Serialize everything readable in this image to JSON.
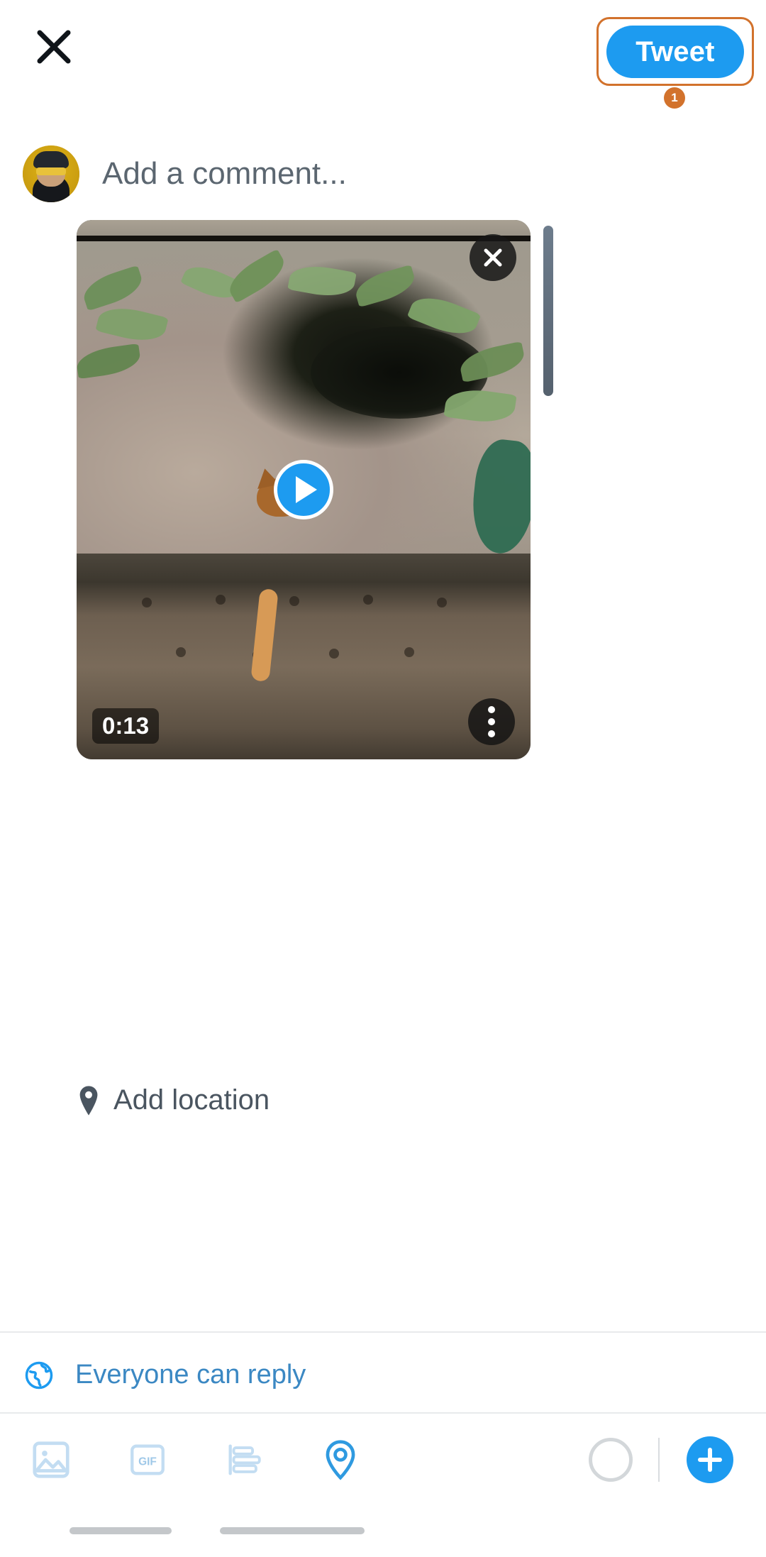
{
  "topbar": {
    "close_icon": "close-icon",
    "tweet_button_label": "Tweet",
    "tweet_button_color": "#1d9bf0",
    "annotation_badge": "1",
    "annotation_color": "#d2722c"
  },
  "composer": {
    "avatar_alt": "user-avatar",
    "placeholder": "Add a comment..."
  },
  "media": {
    "type": "video",
    "duration": "0:13",
    "close_icon": "close-icon",
    "play_icon": "play-icon",
    "more_icon": "more-options-icon",
    "play_button_color": "#1d9bf0"
  },
  "location": {
    "icon": "location-pin-icon",
    "label": "Add location"
  },
  "reply_scope": {
    "icon": "globe-icon",
    "label": "Everyone can reply",
    "color": "#3b88c3"
  },
  "toolbar": {
    "items": [
      {
        "name": "image-icon",
        "label": ""
      },
      {
        "name": "gif-icon",
        "label": "GIF"
      },
      {
        "name": "poll-icon",
        "label": ""
      },
      {
        "name": "location-pin-icon",
        "label": ""
      }
    ],
    "char_counter": "",
    "add_button_icon": "plus-icon",
    "add_button_color": "#1d9bf0"
  }
}
